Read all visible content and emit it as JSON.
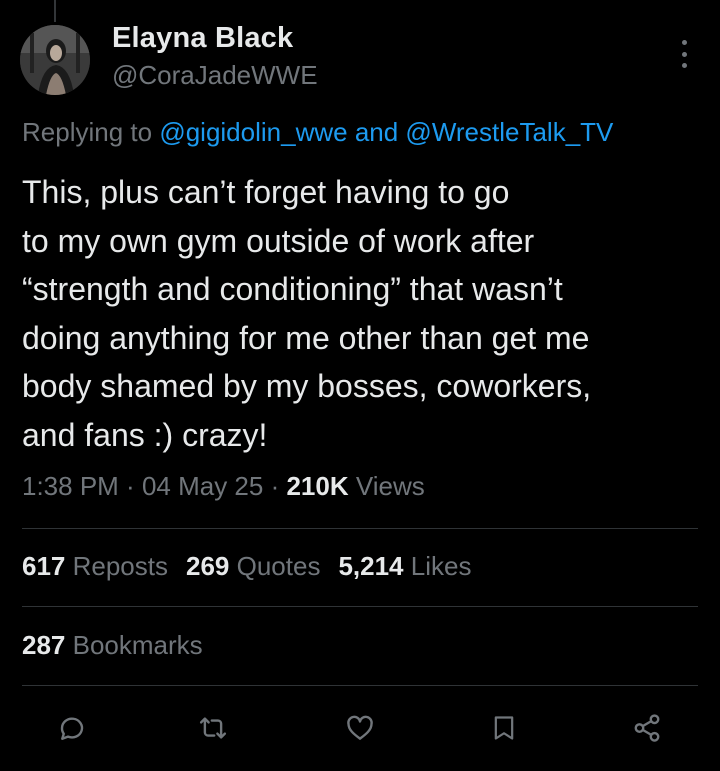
{
  "author": {
    "name": "Elayna Black",
    "handle": "@CoraJadeWWE",
    "avatar_icon": "profile-photo"
  },
  "reply": {
    "prefix": "Replying to ",
    "mention1": "@gigidolin_wwe",
    "joiner": " and ",
    "mention2": "@WrestleTalk_TV"
  },
  "tweet": {
    "lines": [
      "This, plus can’t forget having to go",
      "to my own gym outside of work after",
      "“strength and conditioning” that wasn’t",
      "doing anything for me other than get me",
      "body shamed by my bosses, coworkers,",
      "and fans :) crazy!"
    ]
  },
  "meta": {
    "time": "1:38 PM",
    "separator": " · ",
    "date": "04 May 25",
    "views_count": "210K",
    "views_label": " Views"
  },
  "stats": {
    "reposts_count": "617",
    "reposts_label": " Reposts",
    "quotes_count": "269",
    "quotes_label": " Quotes",
    "likes_count": "5,214",
    "likes_label": " Likes",
    "bookmarks_count": "287",
    "bookmarks_label": " Bookmarks"
  },
  "actions": [
    "reply-icon",
    "repost-icon",
    "like-icon",
    "bookmark-icon",
    "share-icon"
  ],
  "colors": {
    "background": "#000000",
    "text_primary": "#e7e9ea",
    "text_secondary": "#71767b",
    "link": "#1d9bf0",
    "divider": "#2f3336"
  }
}
